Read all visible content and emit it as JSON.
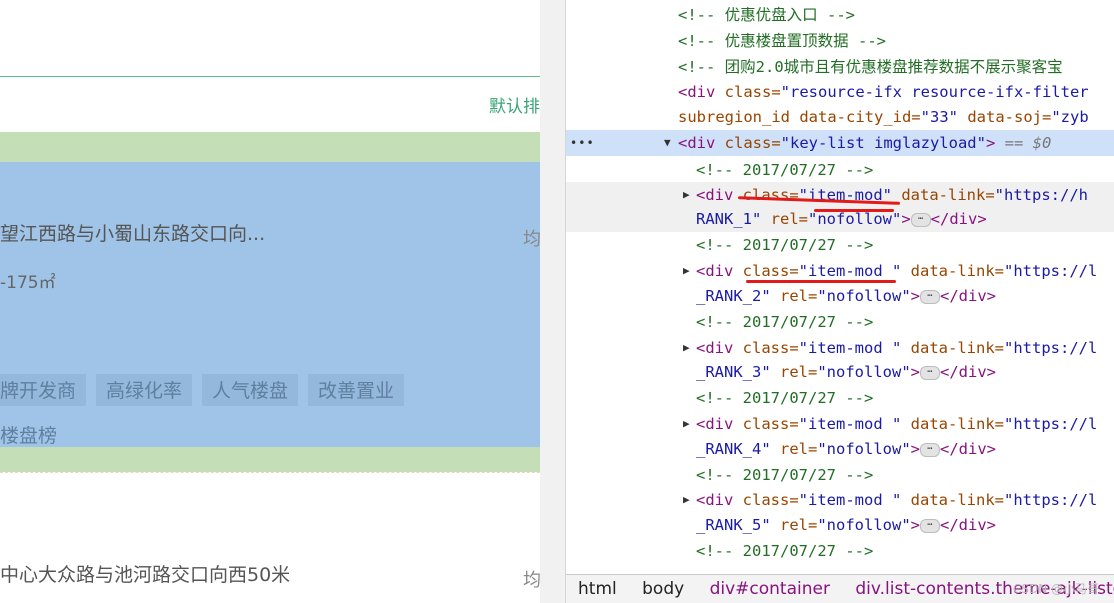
{
  "page": {
    "sort_label": "默认排",
    "listing1": {
      "address": "望江西路与小蜀山东路交口向...",
      "area": "-175㎡",
      "tags": [
        "牌开发商",
        "高绿化率",
        "人气楼盘",
        "改善置业"
      ],
      "rank": "楼盘榜",
      "side": "均"
    },
    "listing2": {
      "address": "中心大众路与池河路交口向西50米",
      "side": "均"
    }
  },
  "devtools": {
    "lines": {
      "c1": "<!-- 优惠优盘入口 -->",
      "c2": "<!-- 优惠楼盘置顶数据 -->",
      "c3": "<!-- 团购2.0城市且有优惠楼盘推荐数据不展示聚客宝",
      "div_open": "<div",
      "cls_attr": "class=",
      "res_val": "\"resource-ifx resource-ifx-filter",
      "subregion": "subregion_id",
      "city_attr": "data-city_id=",
      "city_val": "\"33\"",
      "soj_attr": "data-soj=",
      "soj_val": "\"zyb",
      "key_val": "\"key-list imglazyload\"",
      "gt": ">",
      "sel_marker": "== $0",
      "date_comment": "<!-- 2017/07/27 -->",
      "item_val": "\"item-mod\"",
      "item_val2": "\"item-mod \"",
      "link_attr": "data-link=",
      "link_val": "\"https://h",
      "link_val2": "\"https://l",
      "rank1": "RANK_1\"",
      "rank2": "_RANK_2\"",
      "rank3": "_RANK_3\"",
      "rank4": "_RANK_4\"",
      "rank5": "_RANK_5\"",
      "rel_attr": "rel=",
      "rel_val": "\"nofollow\"",
      "close_div": "</div>",
      "ellipsis": "⋯"
    },
    "breadcrumbs": [
      "html",
      "body",
      "div#container",
      "div.list-contents.theme-ajk-listcont"
    ],
    "watermark": "CSDN @小马哥"
  }
}
